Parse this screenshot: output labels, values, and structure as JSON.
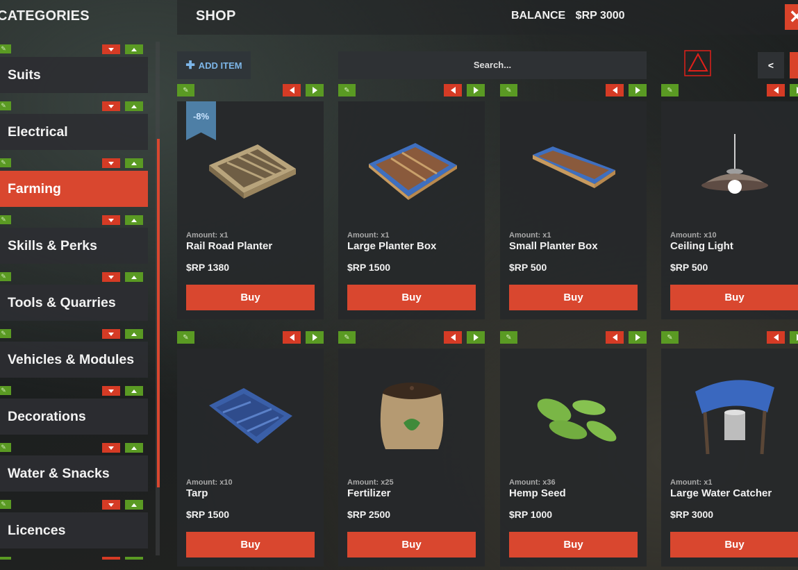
{
  "header": {
    "categories_title": "CATEGORIES",
    "shop_title": "SHOP",
    "balance_label": "BALANCE",
    "balance_value": "$RP 3000",
    "close_glyph": "✕"
  },
  "sidebar": {
    "items": [
      {
        "label": "Suits",
        "active": false
      },
      {
        "label": "Electrical",
        "active": false
      },
      {
        "label": "Farming",
        "active": true
      },
      {
        "label": "Skills & Perks",
        "active": false
      },
      {
        "label": "Tools & Quarries",
        "active": false
      },
      {
        "label": "Vehicles & Modules",
        "active": false
      },
      {
        "label": "Decorations",
        "active": false
      },
      {
        "label": "Water & Snacks",
        "active": false
      },
      {
        "label": "Licences",
        "active": false
      }
    ]
  },
  "toolbar": {
    "add_item_label": "ADD ITEM",
    "search_placeholder": "Search...",
    "prev_label": "<",
    "warning_icon": "warning-icon"
  },
  "products": [
    {
      "amount": "Amount: x1",
      "name": "Rail Road Planter",
      "price": "$RP 1380",
      "buy": "Buy",
      "discount": "-8%",
      "icon": "railroad-planter-icon"
    },
    {
      "amount": "Amount: x1",
      "name": "Large Planter Box",
      "price": "$RP 1500",
      "buy": "Buy",
      "icon": "large-planter-box-icon"
    },
    {
      "amount": "Amount: x1",
      "name": "Small Planter Box",
      "price": "$RP 500",
      "buy": "Buy",
      "icon": "small-planter-box-icon"
    },
    {
      "amount": "Amount: x10",
      "name": "Ceiling Light",
      "price": "$RP 500",
      "buy": "Buy",
      "icon": "ceiling-light-icon"
    },
    {
      "amount": "Amount: x10",
      "name": "Tarp",
      "price": "$RP 1500",
      "buy": "Buy",
      "icon": "tarp-icon"
    },
    {
      "amount": "Amount: x25",
      "name": "Fertilizer",
      "price": "$RP 2500",
      "buy": "Buy",
      "icon": "fertilizer-icon"
    },
    {
      "amount": "Amount: x36",
      "name": "Hemp Seed",
      "price": "$RP 1000",
      "buy": "Buy",
      "icon": "hemp-seed-icon"
    },
    {
      "amount": "Amount: x1",
      "name": "Large Water Catcher",
      "price": "$RP 3000",
      "buy": "Buy",
      "icon": "water-catcher-icon"
    }
  ],
  "colors": {
    "accent_red": "#d9472f",
    "accent_green": "#5a9a23",
    "accent_blue": "#7db6e8",
    "panel": "#2c2e32"
  }
}
